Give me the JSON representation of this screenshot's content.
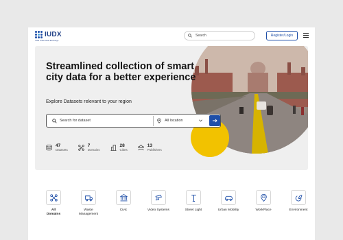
{
  "header": {
    "logo_text": "IUDX",
    "logo_tagline": "India Urban Data Exchange",
    "search_label": "Search",
    "login_label": "Register/Login"
  },
  "hero": {
    "title": "Streamlined collection of smart city data for a better experience",
    "subtitle": "Explore Datasets relevant to your region",
    "search_placeholder": "Search for dataset",
    "location_placeholder": "All location"
  },
  "stats": [
    {
      "value": "47",
      "label": "Datasets",
      "icon": "database-icon"
    },
    {
      "value": "7",
      "label": "Domains",
      "icon": "network-icon"
    },
    {
      "value": "28",
      "label": "Cities",
      "icon": "city-icon"
    },
    {
      "value": "13",
      "label": "Publishers",
      "icon": "publishers-icon"
    }
  ],
  "domains": [
    {
      "label": "All Domains",
      "icon": "network-icon",
      "selected": true
    },
    {
      "label": "Waste Management",
      "icon": "garbage-truck-icon"
    },
    {
      "label": "Civic",
      "icon": "civic-building-icon"
    },
    {
      "label": "Video Systems",
      "icon": "cctv-camera-icon"
    },
    {
      "label": "Street Light",
      "icon": "street-light-icon"
    },
    {
      "label": "Urban Mobility",
      "icon": "car-icon"
    },
    {
      "label": "WorkPlace",
      "icon": "workplace-pin-icon"
    },
    {
      "label": "Environment",
      "icon": "environment-icon"
    }
  ],
  "colors": {
    "brand": "#1f4fa8",
    "accent": "#f2c200",
    "hero_bg": "#efefef"
  }
}
